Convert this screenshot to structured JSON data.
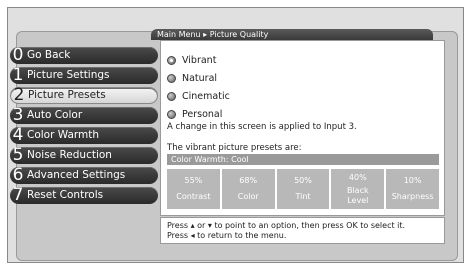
{
  "breadcrumb": {
    "root": "Main Menu",
    "separator": "▸",
    "current": "Picture Quality"
  },
  "sidebar": {
    "items": [
      {
        "num": "0",
        "label": "Go Back",
        "selected": false
      },
      {
        "num": "1",
        "label": "Picture Settings",
        "selected": false
      },
      {
        "num": "2",
        "label": "Picture Presets",
        "selected": true
      },
      {
        "num": "3",
        "label": "Auto Color",
        "selected": false
      },
      {
        "num": "4",
        "label": "Color Warmth",
        "selected": false
      },
      {
        "num": "5",
        "label": "Noise Reduction",
        "selected": false
      },
      {
        "num": "6",
        "label": "Advanced Settings",
        "selected": false
      },
      {
        "num": "7",
        "label": "Reset Controls",
        "selected": false
      }
    ]
  },
  "presets": [
    {
      "label": "Vibrant",
      "selected": true
    },
    {
      "label": "Natural",
      "selected": false
    },
    {
      "label": "Cinematic",
      "selected": false
    },
    {
      "label": "Personal",
      "selected": false
    }
  ],
  "info_text": "A change in this screen is applied to Input 3.",
  "presets_heading": "The vibrant picture presets are:",
  "color_warmth": "Color Warmth: Cool",
  "settings": [
    {
      "value": "55%",
      "label": "Contrast"
    },
    {
      "value": "68%",
      "label": "Color"
    },
    {
      "value": "50%",
      "label": "Tint"
    },
    {
      "value": "40%",
      "label": "Black Level"
    },
    {
      "value": "10%",
      "label": "Sharpness"
    }
  ],
  "help": {
    "line1": "Press ▴ or ▾ to point to an option, then press OK to select it.",
    "line2": "Press ◂ to return to the menu."
  }
}
